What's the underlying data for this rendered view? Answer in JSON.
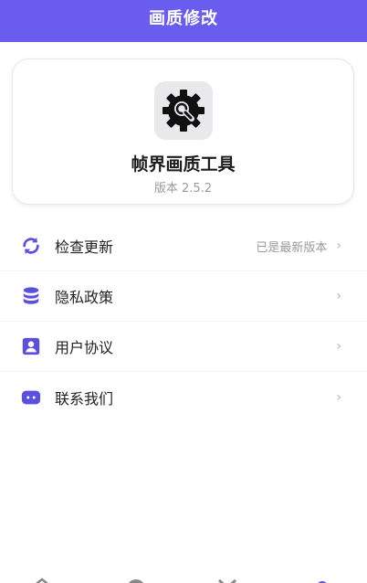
{
  "header": {
    "title": "画质修改"
  },
  "app": {
    "name": "帧界画质工具",
    "version": "版本 2.5.2"
  },
  "menu": [
    {
      "label": "检查更新",
      "value": "已是最新版本",
      "icon": "refresh-icon"
    },
    {
      "label": "隐私政策",
      "value": "",
      "icon": "database-icon"
    },
    {
      "label": "用户协议",
      "value": "",
      "icon": "user-card-icon"
    },
    {
      "label": "联系我们",
      "value": "",
      "icon": "chat-icon"
    }
  ],
  "colors": {
    "accent": "#6b5cf0",
    "icon": "#5b4fe0"
  }
}
